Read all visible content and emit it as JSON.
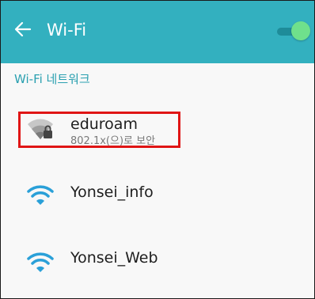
{
  "header": {
    "title": "Wi-Fi",
    "back_icon": "arrow-left-icon",
    "toggle_state": "on",
    "accent_color": "#33b0bf"
  },
  "section": {
    "title": "Wi-Fi 네트워크"
  },
  "networks": [
    {
      "name": "eduroam",
      "security": "802.1x(으)로 보안",
      "icon": "wifi-locked-icon",
      "secured": true,
      "highlighted": true
    },
    {
      "name": "Yonsei_info",
      "icon": "wifi-icon",
      "secured": false
    },
    {
      "name": "Yonsei_Web",
      "icon": "wifi-icon",
      "secured": false
    }
  ]
}
